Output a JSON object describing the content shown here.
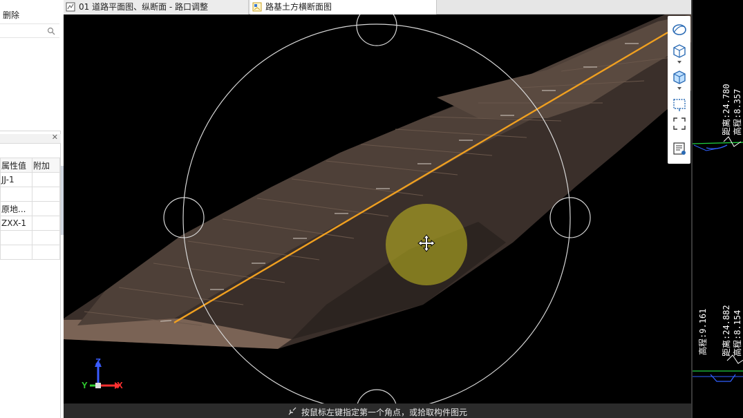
{
  "left_panel": {
    "delete_label": "删除",
    "search_placeholder": "",
    "properties": {
      "headers": [
        "属性值",
        "附加"
      ],
      "rows": [
        [
          "JJ-1",
          ""
        ],
        [
          "",
          ""
        ],
        [
          "原地...",
          ""
        ],
        [
          "ZXX-1",
          ""
        ],
        [
          "",
          ""
        ],
        [
          "",
          ""
        ]
      ]
    }
  },
  "tabs": [
    {
      "label": "01 道路平面图、纵断面 - 路口调整"
    },
    {
      "label": "路基土方横断面图"
    }
  ],
  "viewport": {
    "axis": {
      "x": "X",
      "y": "Y",
      "z": "Z"
    },
    "background": "#000000",
    "road_color": "#4a3d36",
    "centerline_color": "#f0a020"
  },
  "status": {
    "text": "按鼠标左键指定第一个角点，或拾取构件图元"
  },
  "right_strip": {
    "labels": [
      "距离:24.780",
      "高程:8.357",
      "高程:9.161",
      "距离:24.882",
      "高程:8.154"
    ]
  },
  "nav_toolbar": {
    "buttons": [
      "orbit-icon",
      "view-cube-icon",
      "shaded-cube-icon",
      "zoom-window-icon",
      "fit-all-icon",
      "properties-icon"
    ]
  }
}
